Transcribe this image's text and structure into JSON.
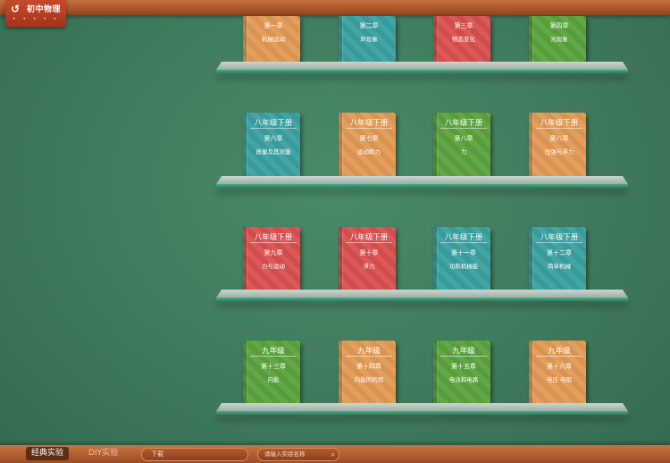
{
  "app": {
    "title": "初中物理",
    "logo_icon": "magnet-icon",
    "logo_subtext": "• • • • •"
  },
  "shelves": [
    {
      "books": [
        {
          "grade": "",
          "chapter": "第一章",
          "topic": "机械运动",
          "color": "#e39a55",
          "variant": "orange"
        },
        {
          "grade": "",
          "chapter": "第二章",
          "topic": "声现象",
          "color": "#3aa0a0",
          "variant": "teal"
        },
        {
          "grade": "",
          "chapter": "第三章",
          "topic": "物态变化",
          "color": "#d9504f",
          "variant": "red"
        },
        {
          "grade": "",
          "chapter": "第四章",
          "topic": "光现象",
          "color": "#5ba33c",
          "variant": "green"
        }
      ]
    },
    {
      "books": [
        {
          "grade": "八年级下册",
          "chapter": "第六章",
          "topic": "质量及其测量",
          "color": "#3aa0a0",
          "variant": "teal"
        },
        {
          "grade": "八年级下册",
          "chapter": "第七章",
          "topic": "运动和力",
          "color": "#e39a55",
          "variant": "orange"
        },
        {
          "grade": "八年级下册",
          "chapter": "第八章",
          "topic": "力",
          "color": "#5ba33c",
          "variant": "green"
        },
        {
          "grade": "八年级下册",
          "chapter": "第八章",
          "topic": "压强与浮力",
          "color": "#e39a55",
          "variant": "orange"
        }
      ]
    },
    {
      "books": [
        {
          "grade": "八年级下册",
          "chapter": "第九章",
          "topic": "力与运动",
          "color": "#d9504f",
          "variant": "red"
        },
        {
          "grade": "八年级下册",
          "chapter": "第十章",
          "topic": "浮力",
          "color": "#d9504f",
          "variant": "red"
        },
        {
          "grade": "八年级下册",
          "chapter": "第十一章",
          "topic": "功和机械能",
          "color": "#3aa0a0",
          "variant": "teal"
        },
        {
          "grade": "八年级下册",
          "chapter": "第十二章",
          "topic": "简单机械",
          "color": "#3aa0a0",
          "variant": "teal"
        }
      ]
    },
    {
      "books": [
        {
          "grade": "九年级",
          "chapter": "第十三章",
          "topic": "内能",
          "color": "#5ba33c",
          "variant": "green"
        },
        {
          "grade": "九年级",
          "chapter": "第十四章",
          "topic": "内能的利用",
          "color": "#e39a55",
          "variant": "orange"
        },
        {
          "grade": "九年级",
          "chapter": "第十五章",
          "topic": "电流和电路",
          "color": "#5ba33c",
          "variant": "green"
        },
        {
          "grade": "九年级",
          "chapter": "第十六章",
          "topic": "电压 电阻",
          "color": "#e39a55",
          "variant": "orange"
        }
      ]
    }
  ],
  "bottom_bar": {
    "tab_classic": "经典实验",
    "tab_diy": "DIY实验",
    "dropdown_label": "下载",
    "search_placeholder": "请输入实验名称",
    "search_icon": "search-icon"
  }
}
